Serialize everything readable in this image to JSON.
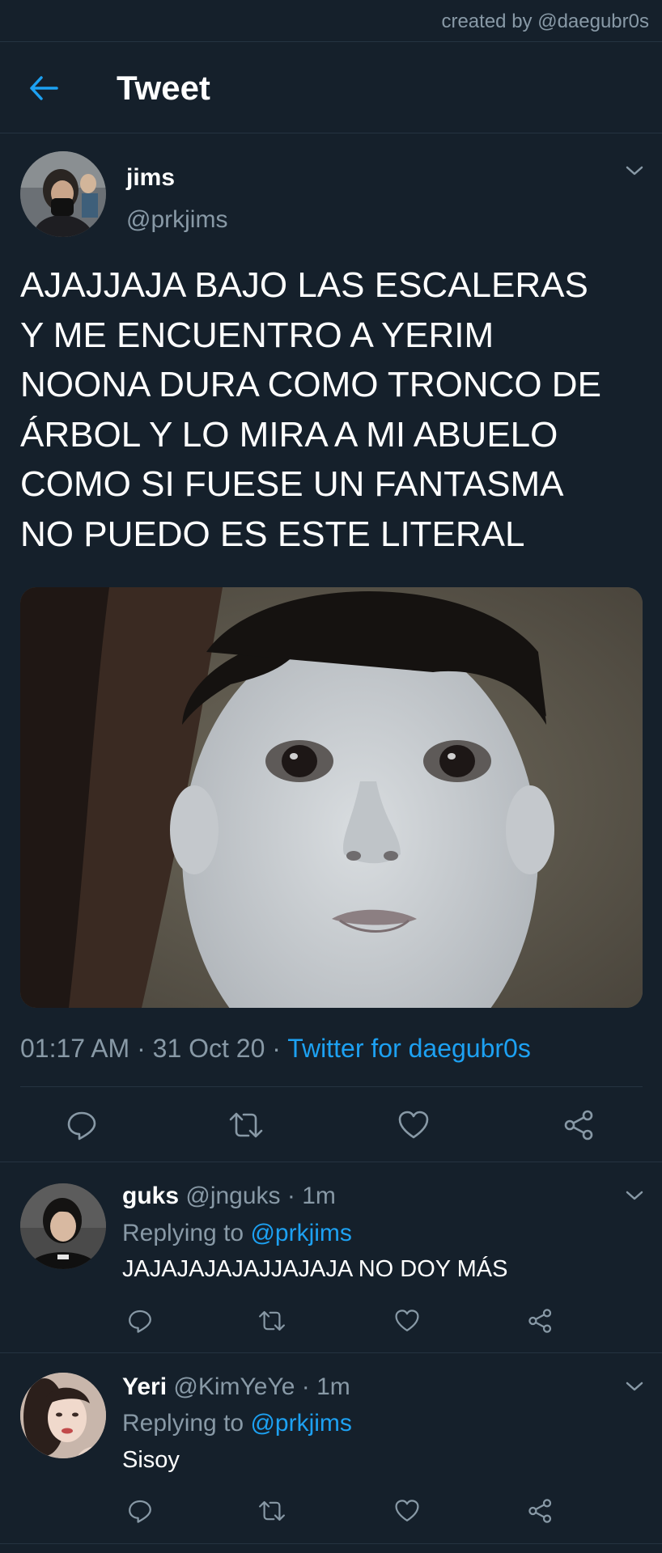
{
  "credit": {
    "text": "created by @daegubr0s"
  },
  "header": {
    "title": "Tweet",
    "back_icon": "arrow-left-icon",
    "accent": "#1da1f2"
  },
  "tweet": {
    "author_name": "jims",
    "author_handle": "@prkjims",
    "text": "AJAJJAJA BAJO LAS ESCALERAS\nY ME ENCUENTRO A YERIM\nNOONA DURA COMO TRONCO DE\nÁRBOL Y LO MIRA A MI ABUELO\nCOMO SI FUESE UN FANTASMA\nNO PUEDO ES ESTE LITERAL",
    "time": "01:17 AM",
    "date": "31 Oct 20",
    "separator": "·",
    "source": "Twitter for daegubr0s"
  },
  "actions": {
    "icons": [
      "reply-icon",
      "retweet-icon",
      "like-icon",
      "share-icon"
    ]
  },
  "replies": [
    {
      "name": "guks",
      "handle": "@jnguks",
      "age": "· 1m",
      "replying_prefix": "Replying to",
      "replying_to": "@prkjims",
      "text": "JAJAJAJAJAJJAJAJA NO DOY MÁS"
    },
    {
      "name": "Yeri",
      "handle": "@KimYeYe",
      "age": "· 1m",
      "replying_prefix": "Replying to",
      "replying_to": "@prkjims",
      "text": "Sisoy"
    }
  ],
  "colors": {
    "background": "#15202b",
    "divider": "#253341",
    "secondary_text": "#8899a6",
    "link": "#1da1f2"
  }
}
